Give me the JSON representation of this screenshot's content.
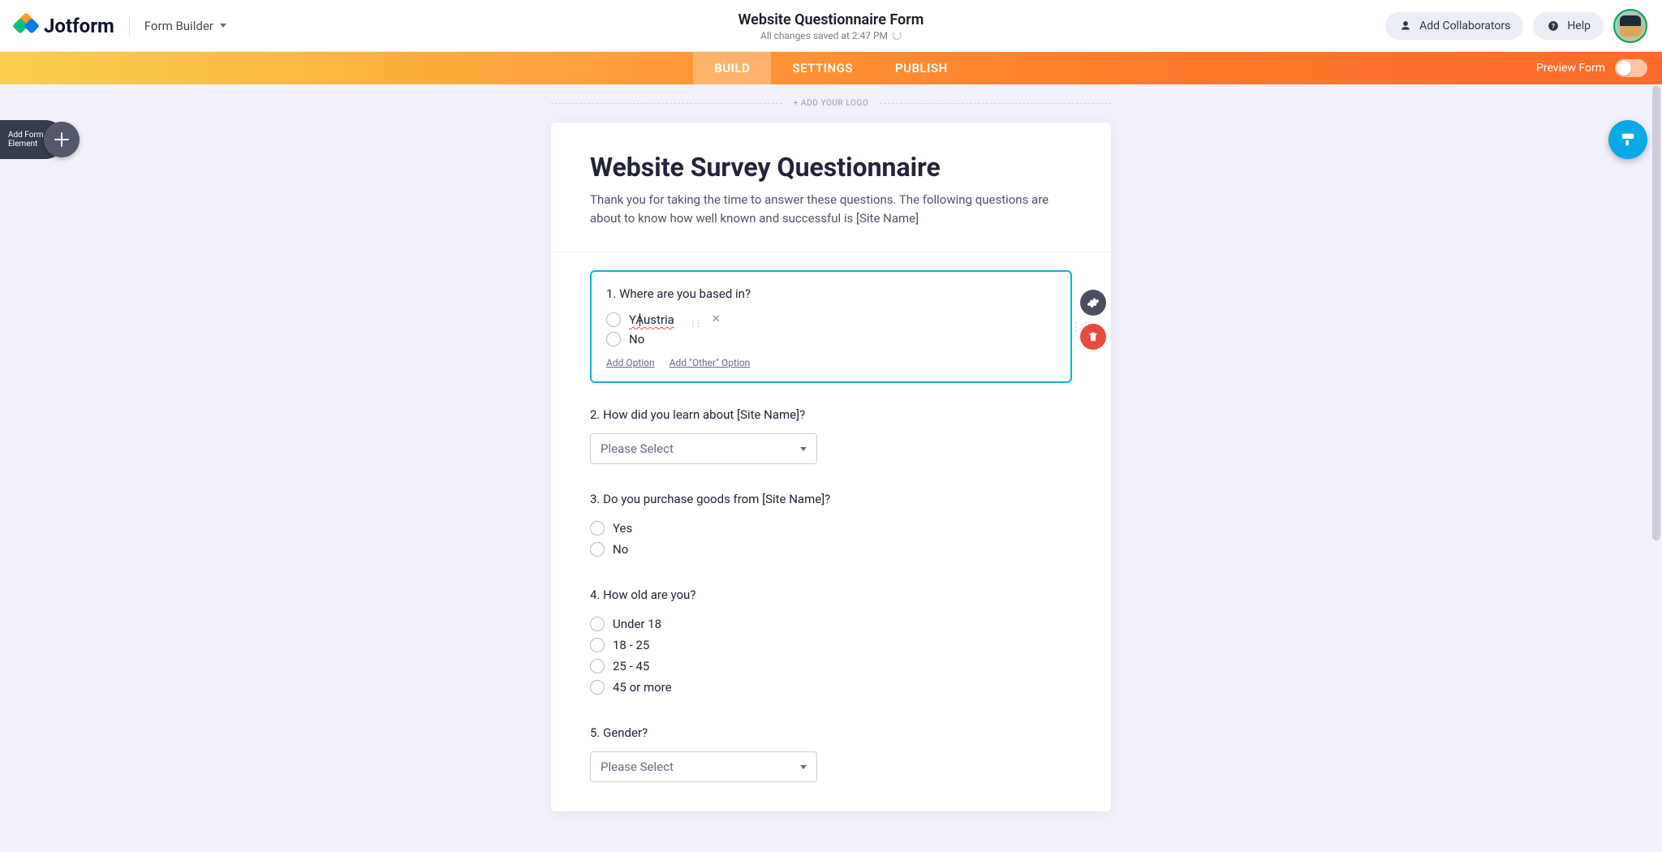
{
  "app": {
    "product": "Jotform",
    "section": "Form Builder"
  },
  "header": {
    "title": "Website Questionnaire Form",
    "saved_status": "All changes saved at 2:47 PM",
    "collaborators_label": "Add Collaborators",
    "help_label": "Help"
  },
  "tabs": {
    "build": "BUILD",
    "settings": "SETTINGS",
    "publish": "PUBLISH",
    "preview_label": "Preview Form"
  },
  "left_panel": {
    "add_element": "Add Form\nElement"
  },
  "canvas": {
    "add_logo": "+ ADD YOUR LOGO",
    "form_heading": "Website Survey Questionnaire",
    "form_sub": "Thank you for taking the time to answer these questions. The following questions are about to know how well known and successful is [Site Name]"
  },
  "q1": {
    "label": "1. Where are you based in?",
    "opt1": "YAustria",
    "opt2": "No",
    "add_option": "Add Option",
    "add_other": "Add \"Other\" Option"
  },
  "q2": {
    "label": "2. How did you learn about [Site Name]?",
    "select_value": "Please Select"
  },
  "q3": {
    "label": "3. Do you purchase goods from [Site Name]?",
    "opt1": "Yes",
    "opt2": "No"
  },
  "q4": {
    "label": "4. How old are you?",
    "opt1": "Under 18",
    "opt2": "18 - 25",
    "opt3": "25 - 45",
    "opt4": "45 or more"
  },
  "q5": {
    "label": "5. Gender?",
    "select_value": "Please Select"
  }
}
